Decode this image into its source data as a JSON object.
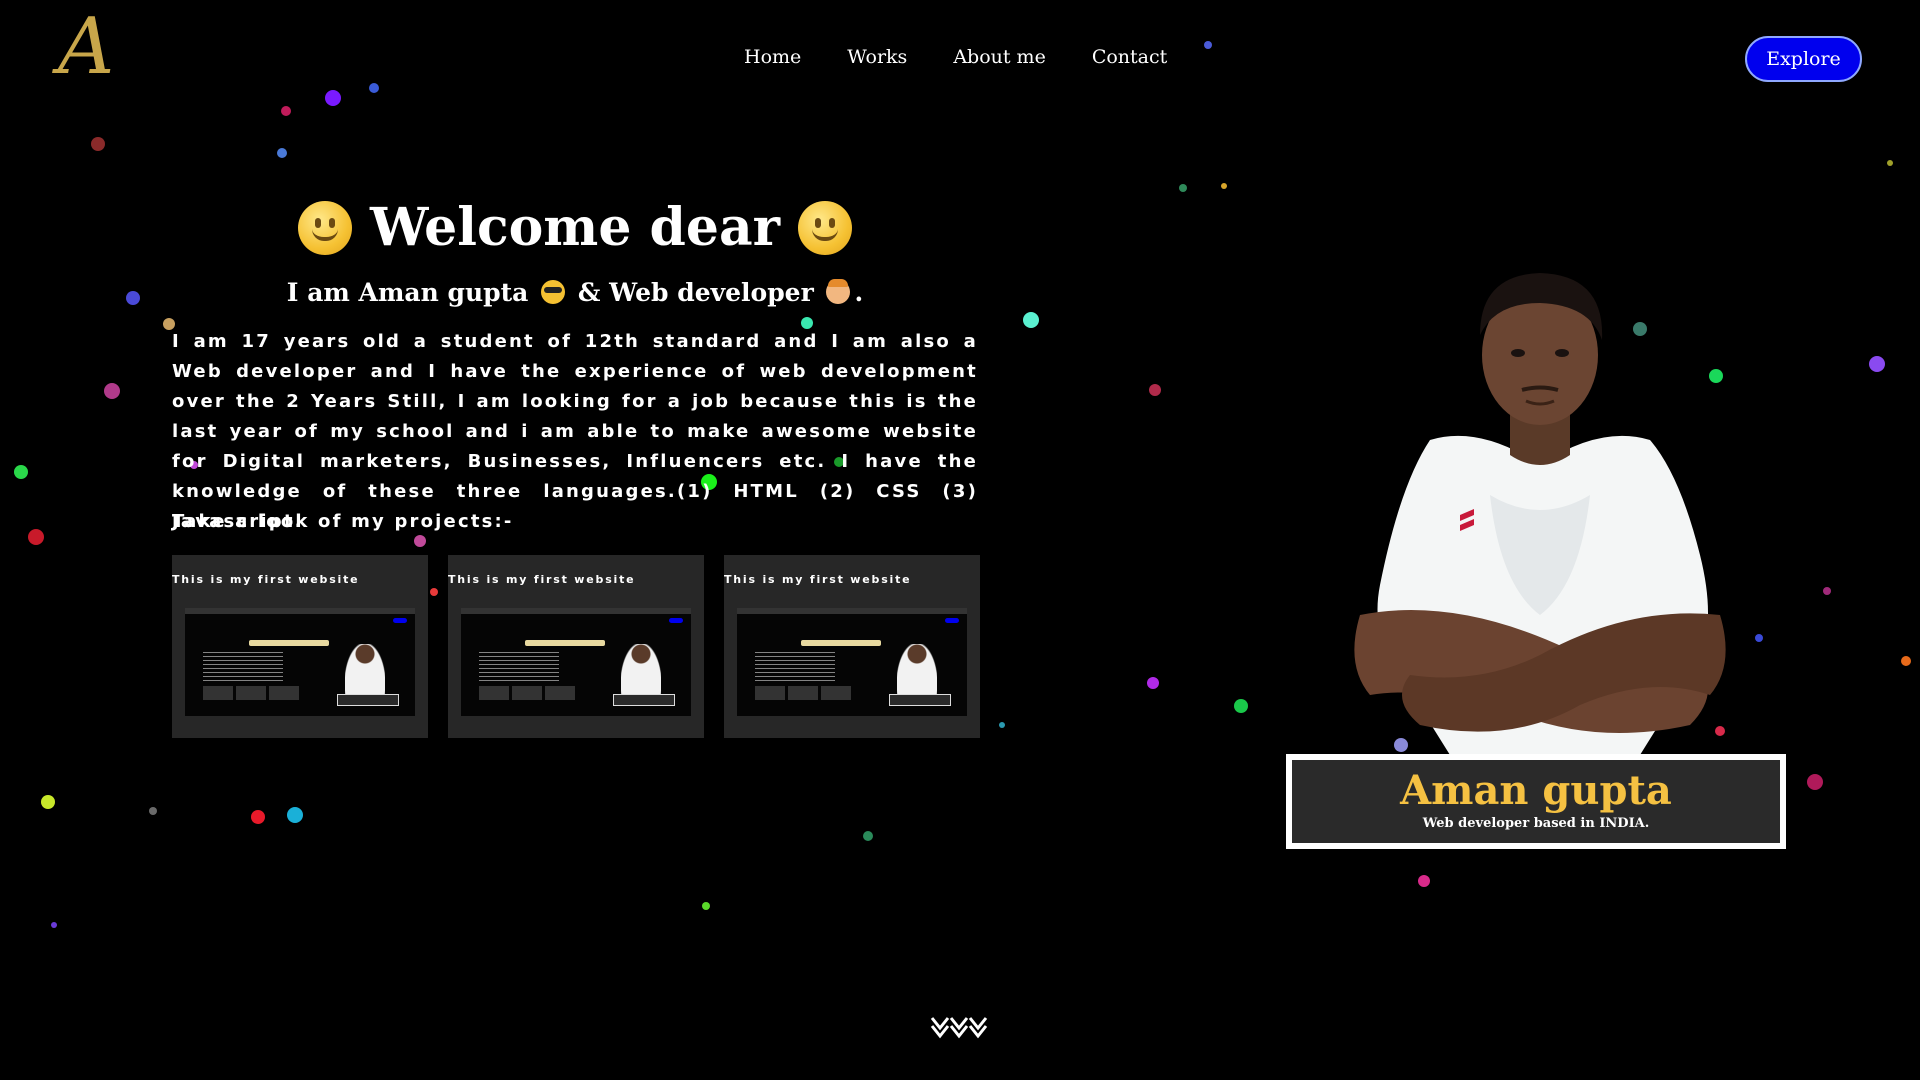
{
  "header": {
    "logo_letter": "A",
    "nav": [
      "Home",
      "Works",
      "About me",
      "Contact"
    ],
    "explore_label": "Explore"
  },
  "hero": {
    "title": "Welcome dear",
    "subtitle_pre": "I am Aman gupta",
    "subtitle_mid": "& Web developer",
    "subtitle_end": ".",
    "bio": "I am 17 years old a student of 12th standard and I am also a Web developer and I have the experience of web development over the 2 Years Still, I am looking for a job because this is the last year of my school and i am able to make awesome website for Digital marketers, Businesses, Influencers etc. I have the knowledge of these three languages.(1) HTML (2) CSS (3) Javascript.",
    "cta": "Take a look of my projects:-"
  },
  "projects": [
    {
      "title": "This is my first website"
    },
    {
      "title": "This is my first website"
    },
    {
      "title": "This is my first website"
    }
  ],
  "profile": {
    "name": "Aman gupta",
    "tagline": "Web developer based in INDIA."
  },
  "colors": {
    "background": "#000000",
    "accent_button": "#0000ee",
    "name_gold": "#f5c142",
    "logo_gold": "#c8a64a"
  },
  "icons": {
    "scroll": "chevrons-down-icon",
    "title_emoji": "smiley-icon"
  }
}
